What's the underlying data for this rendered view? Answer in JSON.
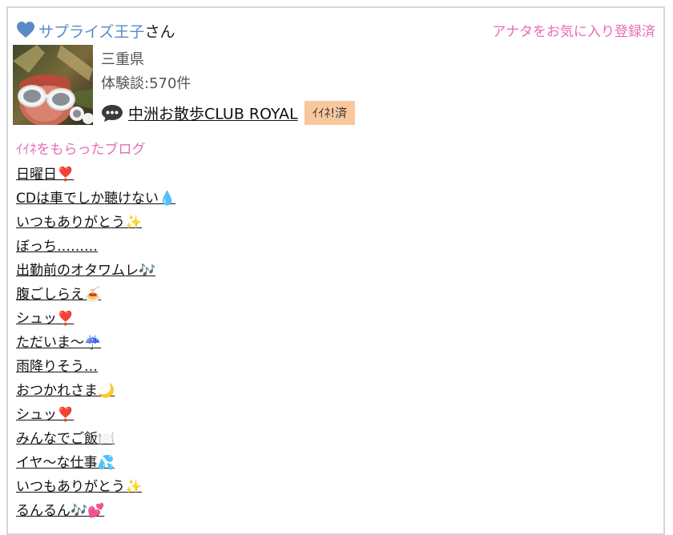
{
  "header": {
    "user_name": "サプライズ王子",
    "user_suffix": "さん",
    "favorite_status": "アナタをお気に入り登録済"
  },
  "profile": {
    "prefecture": "三重県",
    "experience_count": "体験談:570件",
    "shop_name": "中洲お散歩CLUB ROYAL",
    "like_badge": "ｲｲﾈ!済"
  },
  "blogs": {
    "section_title": "ｲｲﾈをもらったブログ",
    "items": [
      {
        "title": "日曜日❣️"
      },
      {
        "title": "CDは車でしか聴けない💧"
      },
      {
        "title": "いつもありがとう✨"
      },
      {
        "title": "ぼっち………"
      },
      {
        "title": "出勤前のオタワムレ🎶"
      },
      {
        "title": "腹ごしらえ🍝"
      },
      {
        "title": "シュッ❣️"
      },
      {
        "title": "ただいま〜☔️"
      },
      {
        "title": "雨降りそう…"
      },
      {
        "title": "おつかれさま🌙"
      },
      {
        "title": "シュッ❣️"
      },
      {
        "title": "みんなでご飯🍽️"
      },
      {
        "title": "イヤ〜な仕事💦"
      },
      {
        "title": "いつもありがとう✨"
      },
      {
        "title": "るんるん🎶💕"
      }
    ]
  },
  "icons": {
    "heart": "heart-icon",
    "chat": "speech-bubble-icon"
  },
  "colors": {
    "user_name": "#5b89c5",
    "accent_pink": "#e56eb5",
    "badge_bg": "#f8c79c"
  }
}
